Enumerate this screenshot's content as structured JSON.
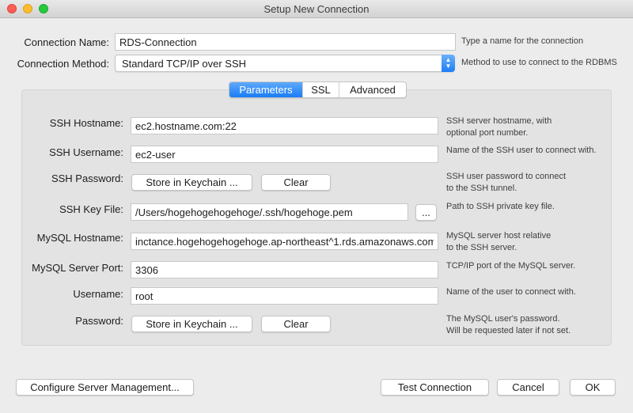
{
  "window": {
    "title": "Setup New Connection"
  },
  "connection": {
    "name_label": "Connection Name:",
    "name_value": "RDS-Connection",
    "name_hint": "Type a name for the connection",
    "method_label": "Connection Method:",
    "method_value": "Standard TCP/IP over SSH",
    "method_hint": "Method to use to connect to the RDBMS"
  },
  "tabs": [
    {
      "label": "Parameters",
      "active": true
    },
    {
      "label": "SSL",
      "active": false
    },
    {
      "label": "Advanced",
      "active": false
    }
  ],
  "params": {
    "ssh_hostname": {
      "label": "SSH Hostname:",
      "value": "ec2.hostname.com:22",
      "hint1": "SSH server hostname, with",
      "hint2": "optional port number."
    },
    "ssh_username": {
      "label": "SSH Username:",
      "value": "ec2-user",
      "hint1": "Name of the SSH user to connect with."
    },
    "ssh_password": {
      "label": "SSH Password:",
      "store_label": "Store in Keychain ...",
      "clear_label": "Clear",
      "hint1": "SSH user password to connect",
      "hint2": "to the SSH tunnel."
    },
    "ssh_keyfile": {
      "label": "SSH Key File:",
      "value": "/Users/hogehogehogehoge/.ssh/hogehoge.pem",
      "browse_label": "...",
      "hint1": "Path to SSH private key file."
    },
    "mysql_hostname": {
      "label": "MySQL Hostname:",
      "value": "inctance.hogehogehogehoge.ap-northeast^1.rds.amazonaws.com",
      "hint1": "MySQL server host relative",
      "hint2": "to the SSH server."
    },
    "mysql_port": {
      "label": "MySQL Server Port:",
      "value": "3306",
      "hint1": "TCP/IP port of the MySQL server."
    },
    "username": {
      "label": "Username:",
      "value": "root",
      "hint1": "Name of the user to connect with."
    },
    "password": {
      "label": "Password:",
      "store_label": "Store in Keychain ...",
      "clear_label": "Clear",
      "hint1": "The MySQL user's password.",
      "hint2": "Will be requested later if not set."
    }
  },
  "footer": {
    "configure_label": "Configure Server Management...",
    "test_label": "Test Connection",
    "cancel_label": "Cancel",
    "ok_label": "OK"
  },
  "colors": {
    "accent": "#1a7cf4"
  },
  "icons": {
    "select_stepper": "chevron-up-down-icon"
  }
}
